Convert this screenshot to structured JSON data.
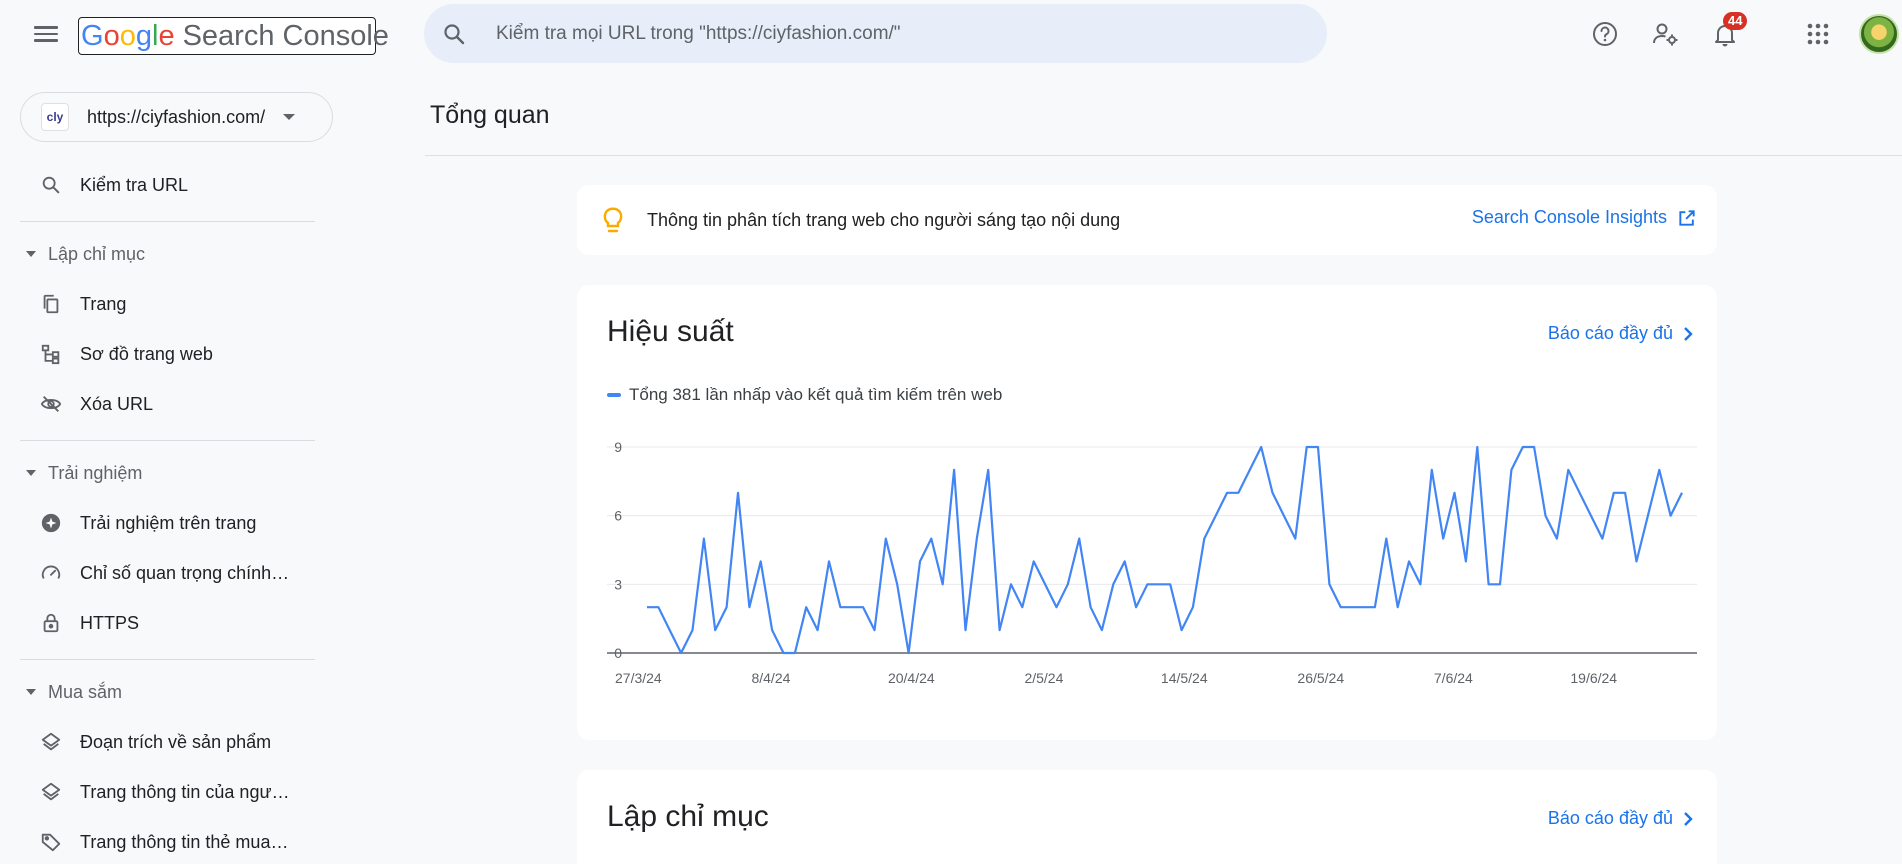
{
  "app": {
    "logo_letters": [
      "G",
      "o",
      "o",
      "g",
      "l",
      "e"
    ],
    "logo_rest": "Search Console"
  },
  "search": {
    "placeholder": "Kiểm tra mọi URL trong \"https://ciyfashion.com/\""
  },
  "header": {
    "notification_count": "44",
    "icons": [
      "help-icon",
      "manage-users-icon",
      "notifications-icon",
      "apps-grid-icon",
      "account-avatar"
    ]
  },
  "property": {
    "favicon_text": "cly",
    "url": "https://ciyfashion.com/"
  },
  "sidebar": {
    "url_inspection": "Kiểm tra URL",
    "sections": [
      {
        "label": "Lập chỉ mục",
        "items": [
          {
            "label": "Trang",
            "icon": "pages-icon"
          },
          {
            "label": "Sơ đồ trang web",
            "icon": "sitemap-icon"
          },
          {
            "label": "Xóa URL",
            "icon": "visibility-off-icon"
          }
        ]
      },
      {
        "label": "Trải nghiệm",
        "items": [
          {
            "label": "Trải nghiệm trên trang",
            "icon": "page-experience-icon"
          },
          {
            "label": "Chỉ số quan trọng chính…",
            "icon": "speed-gauge-icon"
          },
          {
            "label": "HTTPS",
            "icon": "lock-icon"
          }
        ]
      },
      {
        "label": "Mua sắm",
        "items": [
          {
            "label": "Đoạn trích về sản phẩm",
            "icon": "layers-icon"
          },
          {
            "label": "Trang thông tin của ngư…",
            "icon": "layers-icon"
          },
          {
            "label": "Trang thông tin thẻ mua…",
            "icon": "tag-icon"
          }
        ]
      }
    ]
  },
  "main": {
    "page_title": "Tổng quan",
    "insights": {
      "text": "Thông tin phân tích trang web cho người sáng tạo nội dung",
      "link": "Search Console Insights"
    },
    "performance": {
      "title": "Hiệu suất",
      "full_report": "Báo cáo đầy đủ",
      "legend": "Tổng 381 lần nhấp vào kết quả tìm kiếm trên web"
    },
    "indexing": {
      "title": "Lập chỉ mục",
      "full_report": "Báo cáo đầy đủ"
    }
  },
  "chart_data": {
    "type": "line",
    "series": [
      {
        "name": "Tổng 381 lần nhấp vào kết quả tìm kiếm trên web",
        "color": "#4285f4",
        "values": [
          2,
          2,
          1,
          0,
          1,
          5,
          1,
          2,
          7,
          2,
          4,
          1,
          0,
          0,
          2,
          1,
          4,
          2,
          2,
          2,
          1,
          5,
          3,
          0,
          4,
          5,
          3,
          8,
          1,
          5,
          8,
          1,
          3,
          2,
          4,
          3,
          2,
          3,
          5,
          2,
          1,
          3,
          4,
          2,
          3,
          3,
          3,
          1,
          2,
          5,
          6,
          7,
          7,
          8,
          9,
          7,
          6,
          5,
          9,
          9,
          3,
          2,
          2,
          2,
          2,
          5,
          2,
          4,
          3,
          8,
          5,
          7,
          4,
          9,
          3,
          3,
          8,
          9,
          9,
          6,
          5,
          8,
          7,
          6,
          5,
          7,
          7,
          4,
          6,
          8,
          6,
          7
        ]
      }
    ],
    "x_tick_labels": [
      "27/3/24",
      "8/4/24",
      "20/4/24",
      "2/5/24",
      "14/5/24",
      "26/5/24",
      "7/6/24",
      "19/6/24"
    ],
    "x_tick_indices": [
      0,
      12,
      24,
      36,
      48,
      60,
      72,
      84
    ],
    "y_ticks": [
      0,
      3,
      6,
      9
    ],
    "ylim": [
      0,
      9
    ],
    "grid": true
  }
}
